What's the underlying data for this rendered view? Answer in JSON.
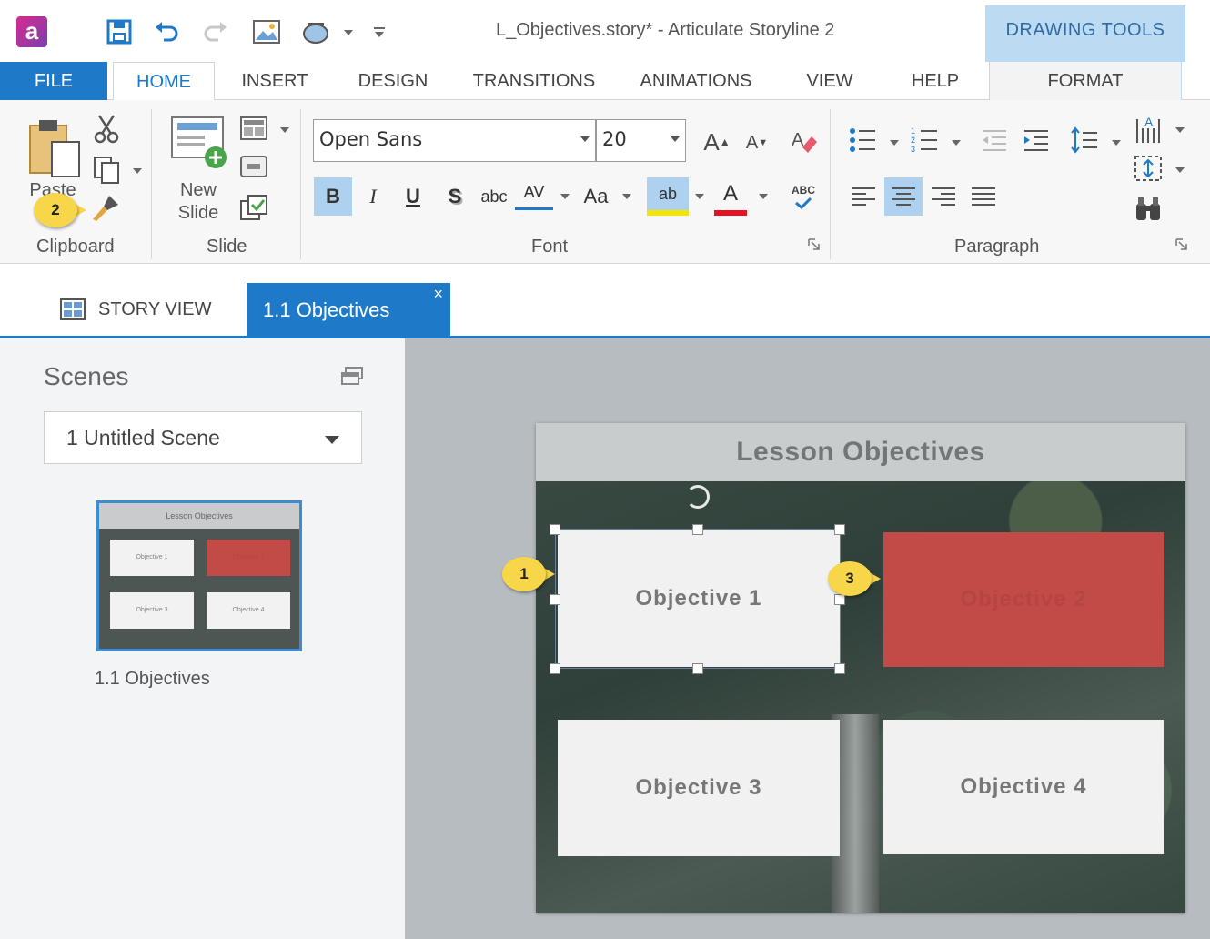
{
  "window": {
    "title": "L_Objectives.story* -  Articulate Storyline 2",
    "app_logo": "a",
    "context_header": "DRAWING TOOLS"
  },
  "quick_access": {
    "icons": [
      "save-icon",
      "undo-icon",
      "redo-icon",
      "insert-picture-icon",
      "preview-icon",
      "customize-icon"
    ]
  },
  "tabs": {
    "file": "FILE",
    "home": "HOME",
    "insert": "INSERT",
    "design": "DESIGN",
    "transitions": "TRANSITIONS",
    "animations": "ANIMATIONS",
    "view": "VIEW",
    "help": "HELP",
    "format": "FORMAT"
  },
  "ribbon": {
    "clipboard": {
      "label": "Clipboard",
      "paste": "Paste"
    },
    "slide": {
      "label": "Slide",
      "new_slide_line1": "New",
      "new_slide_line2": "Slide"
    },
    "font": {
      "label": "Font",
      "family": "Open Sans",
      "size": "20",
      "bold": "B",
      "italic": "I",
      "underline": "U",
      "shadow": "S",
      "strike": "abc",
      "spacing": "AV",
      "case": "Aa",
      "grow": "A",
      "shrink": "A",
      "highlight": "ab",
      "color": "A",
      "spell": "ABC",
      "highlight_color": "#f2e600",
      "font_color": "#e81123"
    },
    "paragraph": {
      "label": "Paragraph"
    }
  },
  "doc_tabs": {
    "story_view": "STORY VIEW",
    "active_slide": "1.1 Objectives",
    "close": "×"
  },
  "scenes": {
    "title": "Scenes",
    "selected": "1 Untitled Scene",
    "thumb_title": "Lesson Objectives",
    "thumb_boxes": [
      "Objective 1",
      "Objective 2",
      "Objective 3",
      "Objective 4"
    ],
    "thumb_caption": "1.1 Objectives"
  },
  "slide": {
    "header": "Lesson Objectives",
    "objectives": [
      "Objective 1",
      "Objective 2",
      "Objective 3",
      "Objective 4"
    ],
    "accent_red": "#c24a47"
  },
  "callouts": [
    "1",
    "2",
    "3"
  ]
}
